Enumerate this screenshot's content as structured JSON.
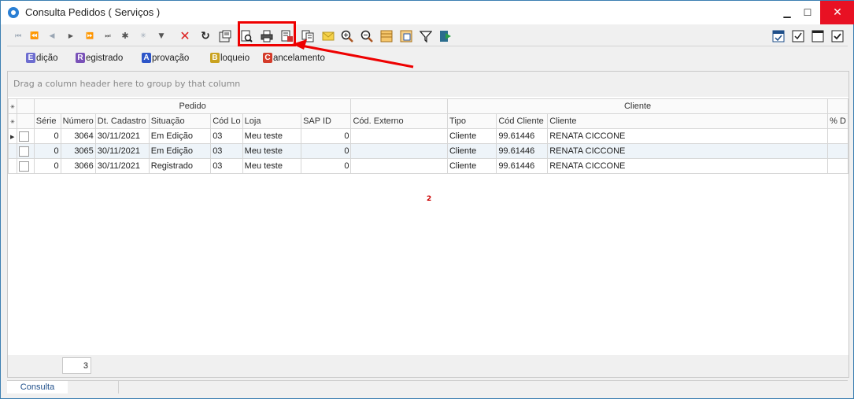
{
  "window": {
    "title": "Consulta Pedidos ( Serviços )",
    "controls": {
      "minimize": "▁",
      "maximize": "☐",
      "close": "✕"
    }
  },
  "toolbar": {
    "nav_icons": [
      "first-icon",
      "prev-page-icon",
      "prev-icon",
      "next-icon",
      "next-page-icon",
      "last-icon",
      "insert-icon",
      "delete-record-icon",
      "filter-down-icon"
    ],
    "action_icons": [
      "cancel-icon",
      "refresh-icon",
      "edit-record-icon",
      "print-preview-icon",
      "print-icon",
      "export-icon",
      "copy-icon",
      "email-icon",
      "zoom-in-icon",
      "zoom-out-icon",
      "layout-icon",
      "config-icon",
      "filter-icon",
      "exit-icon"
    ],
    "right_icons": [
      "select-all-icon",
      "check-icon",
      "window-icon",
      "checkbox-icon"
    ]
  },
  "status_legend": [
    {
      "letter": "E",
      "label": "dição",
      "color": "#6d6dd0"
    },
    {
      "letter": "R",
      "label": "egistrado",
      "color": "#7a52b8"
    },
    {
      "letter": "A",
      "label": "provação",
      "color": "#2d55c8"
    },
    {
      "letter": "B",
      "label": "loqueio",
      "color": "#c9a21f"
    },
    {
      "letter": "C",
      "label": "ancelamento",
      "color": "#d43b2a"
    }
  ],
  "grid": {
    "group_by_placeholder": "Drag a column header here to group by that column",
    "bands": {
      "pedido": "Pedido",
      "cliente": "Cliente"
    },
    "columns": [
      "Série",
      "Número",
      "Dt. Cadastro",
      "Situação",
      "Cód Lo",
      "Loja",
      "SAP ID",
      "Cód. Externo",
      "Tipo",
      "Cód Cliente",
      "Cliente",
      "% D"
    ],
    "rows": [
      [
        "0",
        "3064",
        "30/11/2021",
        "Em Edição",
        "03",
        "Meu teste",
        "0",
        "",
        "Cliente",
        "99.61446",
        "RENATA CICCONE",
        ""
      ],
      [
        "0",
        "3065",
        "30/11/2021",
        "Em Edição",
        "03",
        "Meu teste",
        "0",
        "",
        "Cliente",
        "99.61446",
        "RENATA CICCONE",
        ""
      ],
      [
        "0",
        "3066",
        "30/11/2021",
        "Registrado",
        "03",
        "Meu teste",
        "0",
        "",
        "Cliente",
        "99.61446",
        "RENATA CICCONE",
        ""
      ]
    ],
    "marker": "2",
    "row_count": "3"
  },
  "tabs": {
    "active": "Consulta"
  }
}
